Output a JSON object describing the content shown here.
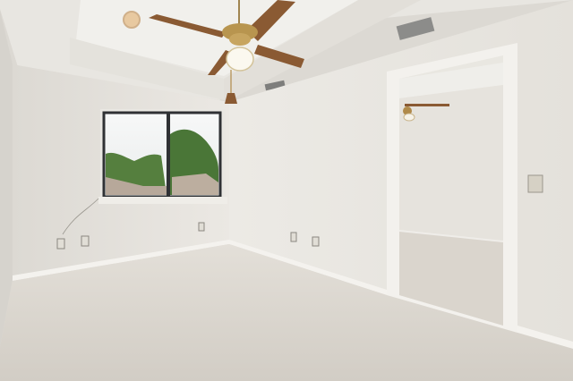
{
  "scene": {
    "kind": "empty carpeted room photo",
    "palette": {
      "wall": "#e9e6e0",
      "wall_shadow": "#d9d6cf",
      "ceiling": "#efede8",
      "carpet": "#d9d5ce",
      "trim": "#f3f1ed",
      "fan_wood": "#8a5a33",
      "fan_brass": "#b08a4a",
      "window_frame": "#2f3134",
      "sky": "#f4f6f7",
      "trees": "#4f7a3b"
    }
  }
}
